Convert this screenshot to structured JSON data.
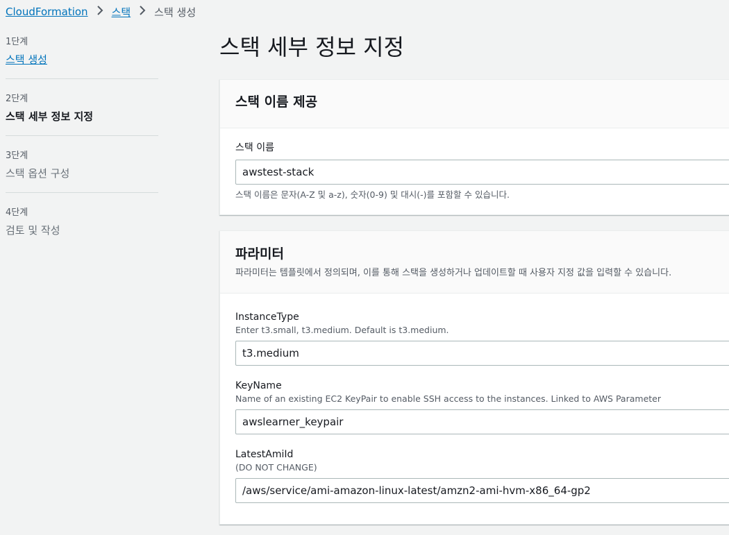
{
  "breadcrumb": {
    "root": "CloudFormation",
    "stacks": "스택",
    "current": "스택 생성"
  },
  "steps": [
    {
      "num": "1단계",
      "label": "스택 생성"
    },
    {
      "num": "2단계",
      "label": "스택 세부 정보 지정"
    },
    {
      "num": "3단계",
      "label": "스택 옵션 구성"
    },
    {
      "num": "4단계",
      "label": "검토 및 작성"
    }
  ],
  "page_title": "스택 세부 정보 지정",
  "stack_name_panel": {
    "title": "스택 이름 제공",
    "field_label": "스택 이름",
    "value": "awstest-stack",
    "help": "스택 이름은 문자(A-Z 및 a-z), 숫자(0-9) 및 대시(-)를 포함할 수 있습니다."
  },
  "params_panel": {
    "title": "파라미터",
    "description": "파라미터는 템플릿에서 정의되며, 이를 통해 스택을 생성하거나 업데이트할 때 사용자 지정 값을 입력할 수 있습니다.",
    "fields": [
      {
        "label": "InstanceType",
        "hint": "Enter t3.small, t3.medium. Default is t3.medium.",
        "value": "t3.medium"
      },
      {
        "label": "KeyName",
        "hint": "Name of an existing EC2 KeyPair to enable SSH access to the instances. Linked to AWS Parameter",
        "value": "awslearner_keypair"
      },
      {
        "label": "LatestAmiId",
        "hint": "(DO NOT CHANGE)",
        "value": "/aws/service/ami-amazon-linux-latest/amzn2-ami-hvm-x86_64-gp2"
      }
    ]
  },
  "icons": {
    "breadcrumb_separator": "chevron-right-icon"
  }
}
